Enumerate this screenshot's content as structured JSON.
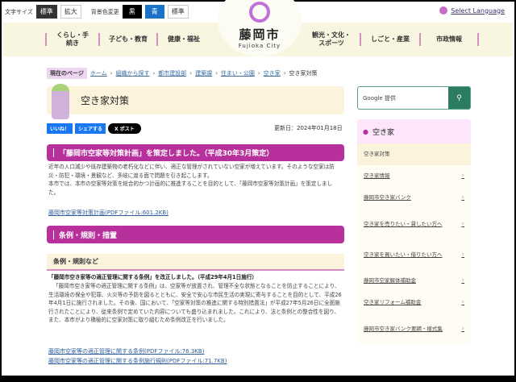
{
  "topbar": {
    "font_size_label": "文字サイズ",
    "font_standard": "標準",
    "font_large": "拡大",
    "bg_label": "背景色変更",
    "bg_black": "黒",
    "bg_blue": "青",
    "bg_standard": "標準"
  },
  "language": "Select Language",
  "nav": [
    "くらし・手続き",
    "子ども・教育",
    "健康・福祉",
    "観光・文化・スポーツ",
    "しごと・産業",
    "市政情報"
  ],
  "logo": {
    "name": "藤岡市",
    "sub": "Fujioka City"
  },
  "breadcrumb": {
    "current_label": "現在のページ",
    "items": [
      "ホーム",
      "組織から探す",
      "都市建設部",
      "建築課",
      "住まい・公園",
      "空き家"
    ],
    "current": "空き家対策"
  },
  "page_title": "空き家対策",
  "social": {
    "like": "いいね！",
    "share": "シェアする",
    "post": "X ポスト"
  },
  "updated": "更新日：2024年01月18日",
  "section1": {
    "heading": "「藤岡市空家等対策計画」を策定しました。（平成30年3月策定）",
    "p1": "近年の人口減少や既存建築物の老朽化などに伴い、適正な管理がされていない空家が増えています。そのような空家は防災・防犯・環境・景観など、多岐に渡る面で問題を引き起こします。",
    "p2": "本市では、本市の空家等対策を総合的かつ計画的に推進することを目的として、「藤岡市空家等対策計画」を策定しました。",
    "link": "藤岡市空家等対策計画(PDFファイル:601.2KB)"
  },
  "section2": {
    "heading": "条例・規則・措置",
    "subheading": "条例・規則など",
    "lead": "「藤岡市空き家等の適正管理に関する条例」を改正しました。（平成29年4月1日施行）",
    "body": "「藤岡市空き家等の適正管理に関する条例」は、空家等が放置され、管理不全な状態となることを防止することにより、生活環境の保全や犯罪、火災等の予防を図るとともに、安全で安心な市民生活の実現に寄与することを目的として、平成26年4月1日に施行されました。その後、国において、「空家等対策の推進に関する特別措置法」が平成27年5月26日に全面施行されたことにより、従来条例で定めていた内容についても盛り込まれました。これにより、法と条例との整合性を図り、また、本市がより積極的に空家対策に取り組むため条例改正を行いました。",
    "links": [
      "藤岡市空家等の適正管理に関する条例(PDFファイル:76.3KB)",
      "藤岡市空家等の適正管理に関する条例施行規則(PDFファイル:71.7KB)"
    ]
  },
  "search": {
    "placeholder": "Google 提供"
  },
  "sidebar": {
    "heading": "空き家",
    "items": [
      "空き家対策",
      "空き家情報",
      "藤岡市空き家バンク",
      "空き家を売りたい・貸したい方へ",
      "空き家を買いたい・借りたい方へ",
      "藤岡市空家解体補助金",
      "空き家リフォーム補助金",
      "藤岡市空き家バンク要綱・様式集"
    ]
  }
}
